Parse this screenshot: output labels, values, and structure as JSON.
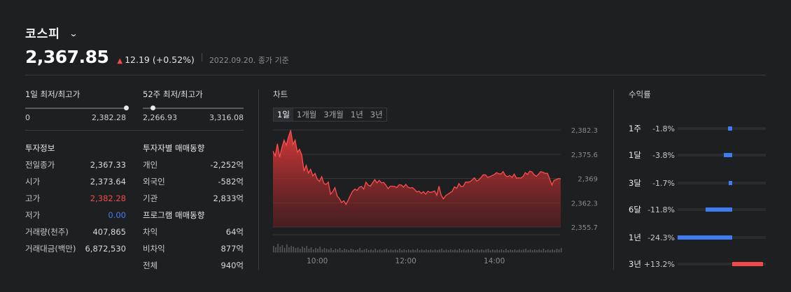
{
  "header": {
    "index_name": "코스피",
    "price": "2,367.85",
    "change": "12.19",
    "change_pct": "(+0.52%)",
    "as_of": "2022.09.20. 종가 기준"
  },
  "ranges": {
    "day": {
      "label": "1일 최저/최고가",
      "low": "0",
      "high": "2,382.28",
      "position": 1.0
    },
    "week52": {
      "label": "52주 최저/최고가",
      "low": "2,266.93",
      "high": "3,316.08",
      "position": 0.1
    }
  },
  "invest_info": {
    "title": "투자정보",
    "rows": [
      {
        "label": "전일종가",
        "value": "2,367.33",
        "tone": "normal"
      },
      {
        "label": "시가",
        "value": "2,373.64",
        "tone": "normal"
      },
      {
        "label": "고가",
        "value": "2,382.28",
        "tone": "up"
      },
      {
        "label": "저가",
        "value": "0.00",
        "tone": "down"
      },
      {
        "label": "거래량(천주)",
        "value": "407,865",
        "tone": "normal"
      },
      {
        "label": "거래대금(백만)",
        "value": "6,872,530",
        "tone": "normal"
      }
    ]
  },
  "investor_trend": {
    "title": "투자자별 매매동향",
    "rows": [
      {
        "label": "개인",
        "value": "-2,252억"
      },
      {
        "label": "외국인",
        "value": "-582억"
      },
      {
        "label": "기관",
        "value": "2,833억"
      }
    ]
  },
  "program_trend": {
    "title": "프로그램 매매동향",
    "rows": [
      {
        "label": "차익",
        "value": "64억"
      },
      {
        "label": "비차익",
        "value": "877억"
      },
      {
        "label": "전체",
        "value": "940억"
      }
    ]
  },
  "chart_panel": {
    "title": "차트",
    "tabs": [
      "1일",
      "1개월",
      "3개월",
      "1년",
      "3년"
    ],
    "active_tab": "1일"
  },
  "chart_data": {
    "type": "area",
    "y_ticks": [
      "2,382.3",
      "2,375.6",
      "2,369",
      "2,362.3",
      "2,355.7"
    ],
    "y_tick_values": [
      2382.3,
      2375.6,
      2369,
      2362.3,
      2355.7
    ],
    "x_ticks": [
      "10:00",
      "12:00",
      "14:00"
    ],
    "x_tick_values": [
      60,
      180,
      300
    ],
    "x_range": [
      0,
      390
    ],
    "y_range": [
      2355.7,
      2382.3
    ],
    "series": [
      {
        "x": [
          0,
          3,
          6,
          9,
          12,
          15,
          18,
          21,
          24,
          27,
          30,
          33,
          36,
          39,
          42,
          45,
          48,
          51,
          54,
          57,
          60,
          63,
          66,
          69,
          72,
          75,
          78,
          81,
          84,
          87,
          90,
          93,
          96,
          99,
          102,
          105,
          108,
          111,
          114,
          117,
          120,
          123,
          126,
          129,
          132,
          135,
          138,
          141,
          144,
          147,
          150,
          153,
          156,
          159,
          162,
          165,
          168,
          171,
          174,
          177,
          180,
          183,
          186,
          189,
          192,
          195,
          198,
          201,
          204,
          207,
          210,
          213,
          216,
          219,
          222,
          225,
          228,
          231,
          234,
          237,
          240,
          243,
          246,
          249,
          252,
          255,
          258,
          261,
          264,
          267,
          270,
          273,
          276,
          279,
          282,
          285,
          288,
          291,
          294,
          297,
          300,
          303,
          306,
          309,
          312,
          315,
          318,
          321,
          324,
          327,
          330,
          333,
          336,
          339,
          342,
          345,
          348,
          351,
          354,
          357,
          360,
          363,
          366,
          369,
          372,
          375,
          378,
          381,
          384,
          387,
          390
        ],
        "values": [
          2376.5,
          2375.2,
          2378.5,
          2374.8,
          2377.4,
          2379.5,
          2378.1,
          2380.4,
          2382.2,
          2378.3,
          2379.5,
          2376.2,
          2377.0,
          2375.4,
          2371.0,
          2372.6,
          2370.5,
          2371.5,
          2369.7,
          2370.4,
          2368.8,
          2368.2,
          2369.5,
          2367.6,
          2367.4,
          2368.0,
          2364.7,
          2365.4,
          2366.5,
          2364.2,
          2363.5,
          2362.4,
          2362.9,
          2361.9,
          2363.1,
          2364.4,
          2365.5,
          2366.1,
          2365.7,
          2366.6,
          2366.8,
          2366.1,
          2368.0,
          2367.2,
          2366.9,
          2367.8,
          2368.7,
          2367.8,
          2368.5,
          2367.8,
          2367.9,
          2367.2,
          2366.2,
          2366.9,
          2366.9,
          2366.8,
          2366.5,
          2367.3,
          2367.2,
          2366.6,
          2367.4,
          2366.6,
          2366.4,
          2366.5,
          2366.0,
          2365.3,
          2365.5,
          2364.9,
          2365.4,
          2364.7,
          2365.5,
          2365.2,
          2365.3,
          2365.6,
          2364.4,
          2366.9,
          2364.4,
          2363.4,
          2364.3,
          2364.7,
          2365.1,
          2365.5,
          2366.7,
          2366.3,
          2367.6,
          2366.8,
          2366.9,
          2368.0,
          2368.0,
          2368.1,
          2368.6,
          2369.2,
          2368.3,
          2368.6,
          2369.3,
          2370.0,
          2370.0,
          2369.3,
          2369.5,
          2369.8,
          2370.1,
          2370.6,
          2370.3,
          2370.2,
          2370.9,
          2369.8,
          2369.5,
          2369.8,
          2369.3,
          2370.2,
          2369.1,
          2369.2,
          2369.1,
          2369.6,
          2370.6,
          2370.1,
          2371.0,
          2370.8,
          2370.0,
          2369.6,
          2370.2,
          2370.9,
          2370.7,
          2370.4,
          2370.4,
          2368.9,
          2367.2,
          2368.5,
          2368.7,
          2369.0,
          2368.9
        ]
      }
    ],
    "volume": [
      9,
      7,
      12,
      8,
      10,
      6,
      11,
      7,
      9,
      8,
      6,
      7,
      5,
      8,
      6,
      9,
      5,
      7,
      4,
      6,
      5,
      8,
      4,
      6,
      5,
      4,
      6,
      3,
      5,
      4,
      6,
      3,
      5,
      4,
      3,
      5,
      4,
      3,
      4,
      6,
      3,
      4,
      5,
      3,
      4,
      3,
      5,
      3,
      4,
      3,
      4,
      5,
      3,
      4,
      3,
      4,
      3,
      5,
      3,
      4,
      3,
      4,
      3,
      4,
      3,
      5,
      3,
      4,
      3,
      4,
      3,
      4,
      3,
      4,
      3,
      4,
      5,
      3,
      4,
      3,
      4,
      3,
      4,
      3,
      5,
      3,
      4,
      3,
      4,
      3,
      5,
      3,
      4,
      3,
      4,
      3,
      4,
      5,
      3,
      4,
      3,
      4,
      3,
      4,
      3,
      5,
      3,
      4,
      3,
      4,
      3,
      4,
      3,
      4,
      5,
      3,
      4,
      3,
      4,
      3,
      4,
      3,
      5,
      3,
      4,
      3,
      4,
      3,
      5,
      4,
      6
    ]
  },
  "returns": {
    "title": "수익률",
    "rows": [
      {
        "period": "1주",
        "value": "-1.8%",
        "pct": -1.8
      },
      {
        "period": "1달",
        "value": "-3.8%",
        "pct": -3.8
      },
      {
        "period": "3달",
        "value": "-1.7%",
        "pct": -1.7
      },
      {
        "period": "6달",
        "value": "-11.8%",
        "pct": -11.8
      },
      {
        "period": "1년",
        "value": "-24.3%",
        "pct": -24.3
      },
      {
        "period": "3년",
        "value": "+13.2%",
        "pct": 13.2
      }
    ]
  },
  "colors": {
    "up": "#f24a4a",
    "down": "#3f7cf4",
    "background": "#1e1f21"
  }
}
